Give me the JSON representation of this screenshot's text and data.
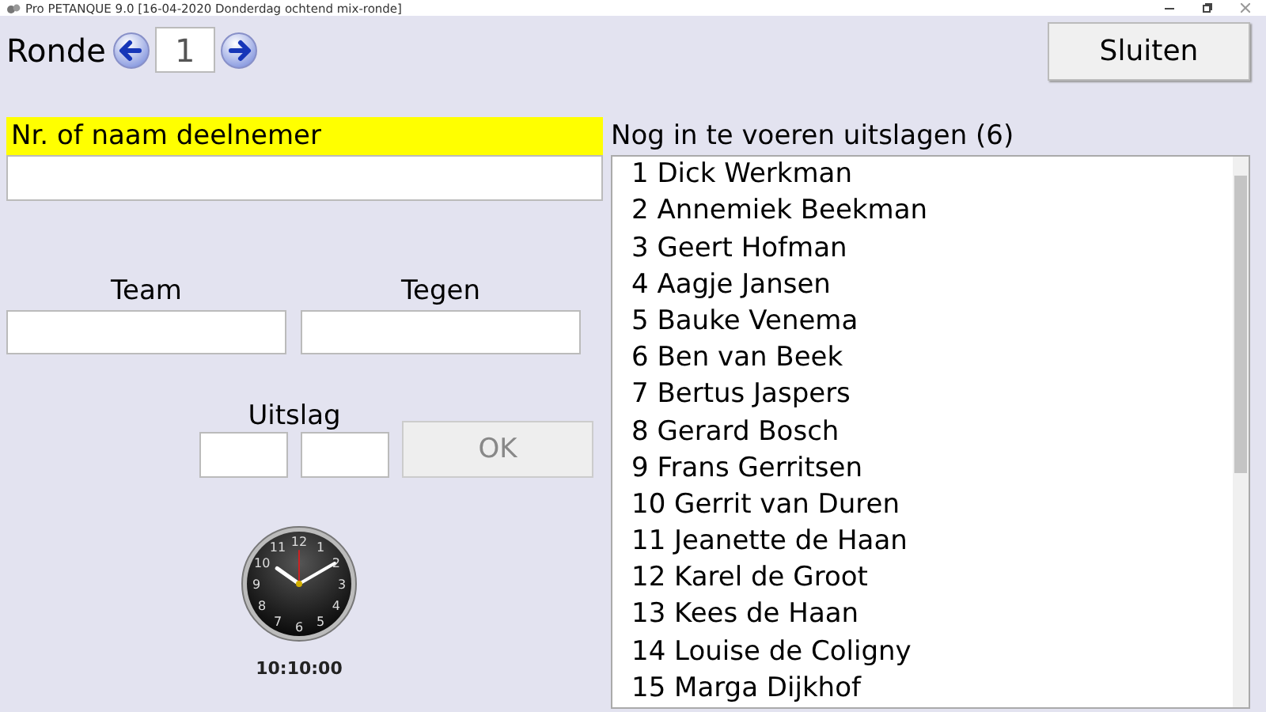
{
  "window": {
    "title": "Pro PETANQUE 9.0 [16-04-2020 Donderdag ochtend mix-ronde]"
  },
  "round": {
    "label": "Ronde",
    "value": "1"
  },
  "close_button": "Sluiten",
  "participant": {
    "label": "Nr. of naam deelnemer"
  },
  "team": {
    "label": "Team"
  },
  "opponent": {
    "label": "Tegen"
  },
  "result": {
    "label": "Uitslag",
    "ok_button": "OK",
    "ok_disabled": true
  },
  "clock": {
    "numerals": [
      "12",
      "11",
      "1",
      "10",
      "2",
      "9",
      "3",
      "8",
      "4",
      "7",
      "5",
      "6"
    ],
    "time": "10:10:00"
  },
  "pending": {
    "title": "Nog in te voeren uitslagen (6)",
    "items": [
      "1 Dick Werkman",
      "2 Annemiek Beekman",
      "3 Geert Hofman",
      "4 Aagje Jansen",
      "5 Bauke Venema",
      "6 Ben van Beek",
      "7 Bertus Jaspers",
      "8 Gerard Bosch",
      "9 Frans Gerritsen",
      "10 Gerrit van Duren",
      "11 Jeanette de Haan",
      "12 Karel de Groot",
      "13 Kees de Haan",
      "14 Louise de Coligny",
      "15 Marga Dijkhof"
    ]
  }
}
